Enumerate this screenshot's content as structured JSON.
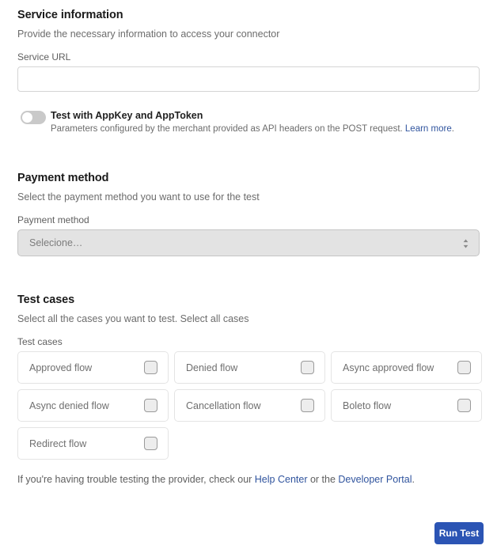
{
  "service_section": {
    "title": "Service information",
    "description": "Provide the necessary information to access your connector",
    "url_label": "Service URL",
    "url_value": "",
    "url_placeholder": "",
    "toggle": {
      "label": "Test with AppKey and AppToken",
      "state": "off",
      "hint_before_link": "Parameters configured by the merchant provided as API headers on the POST request. ",
      "hint_link": "Learn more",
      "hint_after_link": "."
    }
  },
  "payment_section": {
    "title": "Payment method",
    "description": "Select the payment method you want to use for the test",
    "field_label": "Payment method",
    "selected_value": "Selecione…",
    "enabled": false
  },
  "test_cases_section": {
    "title": "Test cases",
    "description": "Select all the cases you want to test. Select all cases",
    "field_label": "Test cases",
    "cases": [
      {
        "label": "Approved flow",
        "checked": false
      },
      {
        "label": "Denied flow",
        "checked": false
      },
      {
        "label": "Async approved flow",
        "checked": false
      },
      {
        "label": "Async denied flow",
        "checked": false
      },
      {
        "label": "Cancellation flow",
        "checked": false
      },
      {
        "label": "Boleto flow",
        "checked": false
      },
      {
        "label": "Redirect flow",
        "checked": false
      }
    ]
  },
  "footer": {
    "help_text_start": "If you're having trouble testing the provider, check our ",
    "help_link_1": "Help Center",
    "help_text_middle": " or the ",
    "help_link_2": "Developer Portal",
    "help_text_end": ".",
    "run_test_label": "Run Test"
  },
  "colors": {
    "accent_blue": "#2b54b4",
    "link_blue": "#30549e",
    "border_gray": "#e4e4e4",
    "disabled_bg": "#e3e3e3"
  }
}
